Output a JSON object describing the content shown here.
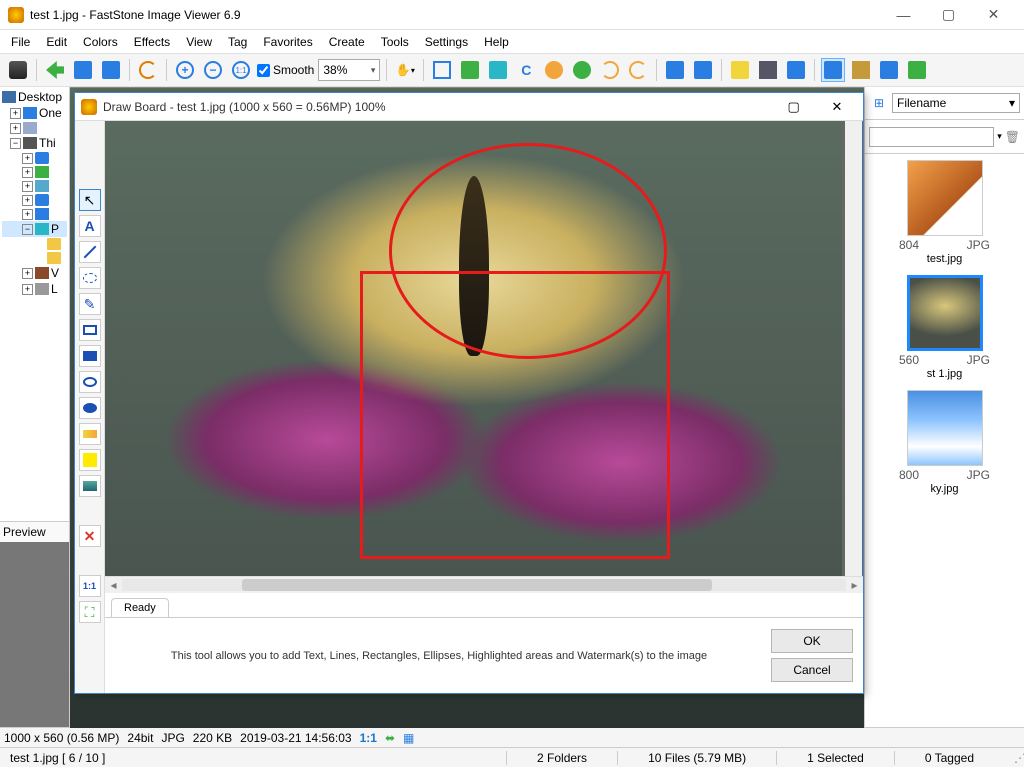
{
  "titlebar": {
    "text": "test 1.jpg  -  FastStone Image Viewer 6.9"
  },
  "menu": [
    "File",
    "Edit",
    "Colors",
    "Effects",
    "View",
    "Tag",
    "Favorites",
    "Create",
    "Tools",
    "Settings",
    "Help"
  ],
  "toolbar": {
    "smooth_label": "Smooth",
    "zoom_value": "38%"
  },
  "tree": {
    "root": "Desktop",
    "items": [
      "One",
      "",
      "Thi",
      "",
      "",
      "",
      "",
      "",
      "",
      "",
      "V",
      "L"
    ]
  },
  "preview_label": "Preview",
  "sort": {
    "label": "Filename"
  },
  "thumbs": [
    {
      "dim": "804",
      "ext": "JPG",
      "name": "test.jpg",
      "cls": "drink"
    },
    {
      "dim": "560",
      "ext": "JPG",
      "name": "st 1.jpg",
      "cls": "bfly",
      "selected": true
    },
    {
      "dim": "800",
      "ext": "JPG",
      "name": "ky.jpg",
      "cls": "sky"
    }
  ],
  "status1": {
    "dims": "1000 x 560 (0.56 MP)",
    "depth": "24bit",
    "fmt": "JPG",
    "size": "220 KB",
    "date": "2019-03-21 14:56:03",
    "ratio": "1:1"
  },
  "status2": {
    "file": "test 1.jpg [ 6 / 10 ]",
    "folders": "2 Folders",
    "files": "10 Files (5.79 MB)",
    "selected": "1 Selected",
    "tagged": "0 Tagged"
  },
  "drawboard": {
    "title": "Draw Board  -  test 1.jpg   (1000 x 560 = 0.56MP)     100%",
    "tab": "Ready",
    "hint": "This tool allows you to add Text, Lines, Rectangles, Ellipses, Highlighted areas and Watermark(s) to the image",
    "ok": "OK",
    "cancel": "Cancel"
  }
}
